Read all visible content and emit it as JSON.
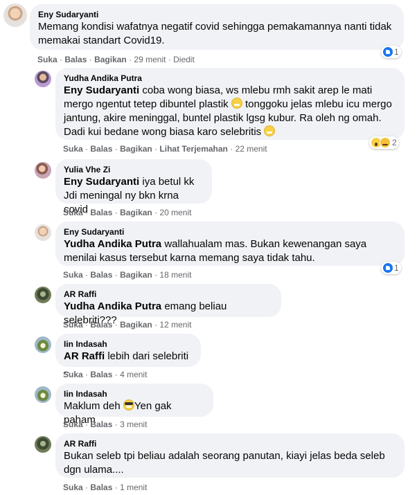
{
  "comments": [
    {
      "name": "Eny Sudaryanti",
      "text": "Memang kondisi wafatnya negatif covid sehingga pemakamannya nanti tidak memakai standart Covid19.",
      "actions": {
        "like": "Suka",
        "reply": "Balas",
        "share": "Bagikan",
        "time": "29 menit",
        "edited": "Diedit"
      },
      "reaction_count": "1"
    },
    {
      "name": "Yudha Andika Putra",
      "mention": "Eny Sudaryanti",
      "text_a": "coba wong biasa, ws mlebu rmh sakit arep le mati mergo ngentut tetep dibuntel plastik",
      "text_b": "tonggoku jelas mlebu icu mergo jantung, akire meninggal, buntel plastik lgsg kubur. Ra oleh ng omah. Dadi kui bedane wong biasa karo selebritis",
      "actions": {
        "like": "Suka",
        "reply": "Balas",
        "share": "Bagikan",
        "translate": "Lihat Terjemahan",
        "time": "22 menit"
      },
      "reaction_count": "2"
    },
    {
      "name": "Yulia Vhe Zi",
      "mention": "Eny Sudaryanti",
      "text_a": "iya betul kk",
      "text_b": "Jdi meningal ny bkn krna covid",
      "actions": {
        "like": "Suka",
        "reply": "Balas",
        "share": "Bagikan",
        "time": "20 menit"
      }
    },
    {
      "name": "Eny Sudaryanti",
      "mention": "Yudha Andika Putra",
      "text": "wallahualam mas. Bukan kewenangan saya menilai kasus tersebut karna memang saya tidak tahu.",
      "actions": {
        "like": "Suka",
        "reply": "Balas",
        "share": "Bagikan",
        "time": "18 menit"
      },
      "reaction_count": "1"
    },
    {
      "name": "AR Raffi",
      "mention": "Yudha Andika Putra",
      "text": "emang beliau selebriti???",
      "actions": {
        "like": "Suka",
        "reply": "Balas",
        "share": "Bagikan",
        "time": "12 menit"
      }
    },
    {
      "name": "Iin Indasah",
      "mention": "AR Raffi",
      "text": "lebih dari selebriti ..",
      "actions": {
        "like": "Suka",
        "reply": "Balas",
        "time": "4 menit"
      }
    },
    {
      "name": "Iin Indasah",
      "text_a": "Maklum deh",
      "text_b": "Yen gak paham",
      "actions": {
        "like": "Suka",
        "reply": "Balas",
        "time": "3 menit"
      }
    },
    {
      "name": "AR Raffi",
      "text": "Bukan seleb tpi beliau adalah seorang panutan, kiayi jelas beda seleb dgn ulama....",
      "actions": {
        "like": "Suka",
        "reply": "Balas",
        "time": "1 menit"
      }
    }
  ],
  "icons": {
    "like_reaction": "like-icon",
    "wow_reaction": "wow-icon",
    "sad_reaction": "sad-icon",
    "grin_emoji": "grin-emoji-icon",
    "cool_emoji": "sunglasses-emoji-icon"
  },
  "colors": {
    "bubble": "#f0f2f5",
    "meta_text": "#65676b",
    "like_blue": "#1877f2"
  }
}
